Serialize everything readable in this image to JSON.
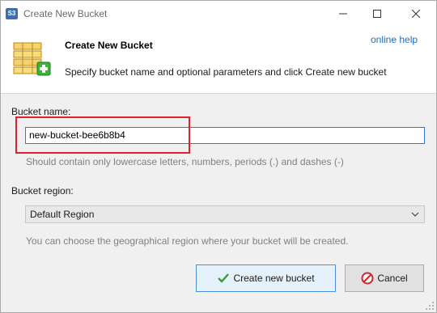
{
  "window": {
    "title": "Create New Bucket",
    "app_icon_text": "S3",
    "controls": [
      "minimize-icon",
      "maximize-icon",
      "close-icon"
    ]
  },
  "header": {
    "title": "Create New Bucket",
    "description": "Specify bucket name and optional parameters and click Create new bucket",
    "help_link": "online help",
    "icon": "bucket-add-icon"
  },
  "form": {
    "bucket_name_label": "Bucket name:",
    "bucket_name_value": "new-bucket-bee6b8b4",
    "bucket_name_hint": "Should contain only lowercase letters, numbers, periods (.) and dashes (-)",
    "bucket_region_label": "Bucket region:",
    "bucket_region_selected": "Default Region",
    "bucket_region_hint": "You can choose the geographical region where your bucket will be created."
  },
  "buttons": {
    "create_label": "Create new bucket",
    "create_icon": "checkmark-icon",
    "cancel_label": "Cancel",
    "cancel_icon": "cancel-icon"
  },
  "colors": {
    "highlight": "#e0202b",
    "link": "#1a6fc2",
    "input_focus_border": "#2f7ad6",
    "default_button_bg": "#e5f1fb"
  }
}
